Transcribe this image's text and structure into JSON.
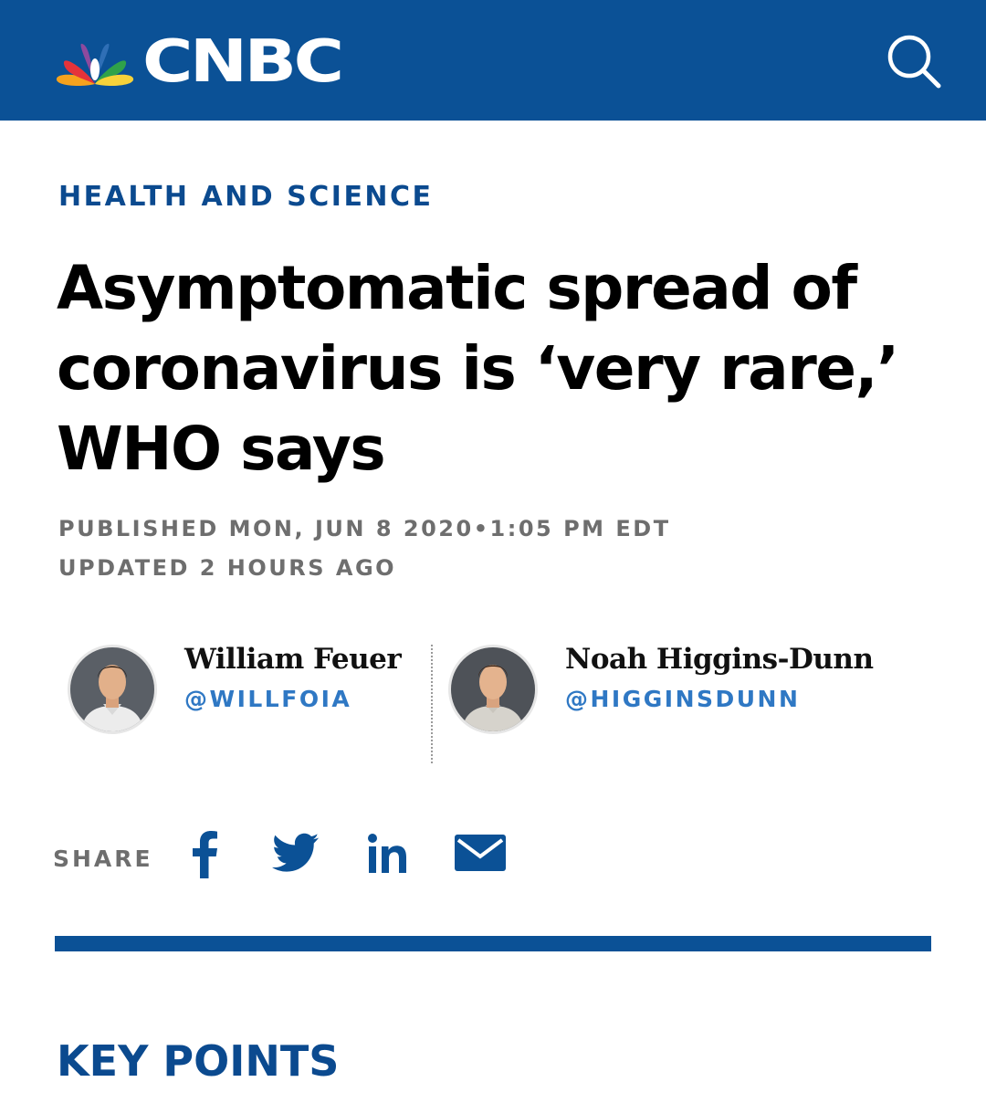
{
  "header": {
    "brand": "CNBC",
    "logo_icon": "nbc-peacock-icon",
    "search_icon": "search-icon",
    "background_color": "#0b5196"
  },
  "article": {
    "section": "HEALTH AND SCIENCE",
    "headline": "Asymptomatic spread of coronavirus is ‘very rare,’ WHO says",
    "published": "PUBLISHED MON, JUN 8 2020•1:05 PM EDT",
    "updated": "UPDATED 2 HOURS AGO"
  },
  "authors": [
    {
      "name": "William Feuer",
      "handle": "@WILLFOIA"
    },
    {
      "name": "Noah Higgins-Dunn",
      "handle": "@HIGGINSDUNN"
    }
  ],
  "share": {
    "label": "SHARE",
    "icons": [
      "facebook-icon",
      "twitter-icon",
      "linkedin-icon",
      "email-icon"
    ],
    "icon_color": "#0b5196"
  },
  "key_points": {
    "heading": "KEY POINTS"
  }
}
